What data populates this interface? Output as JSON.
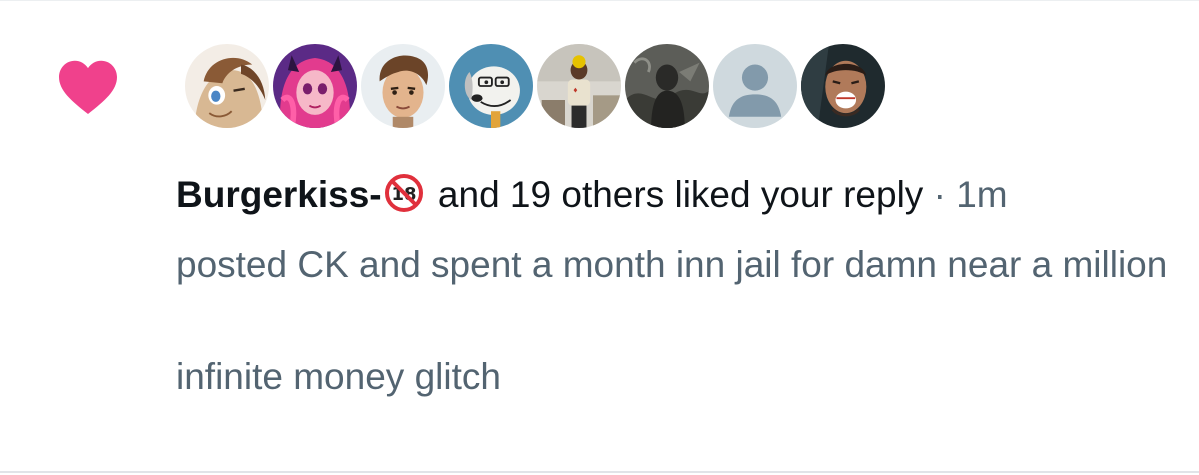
{
  "notification": {
    "type_icon": "heart-icon",
    "accent_color": "#f91880",
    "avatars": [
      {
        "name": "avatar-pony",
        "icon": "avatar-1"
      },
      {
        "name": "avatar-pink-hair",
        "icon": "avatar-2"
      },
      {
        "name": "avatar-brown-hair",
        "icon": "avatar-3"
      },
      {
        "name": "avatar-cartoon-dog",
        "icon": "avatar-4"
      },
      {
        "name": "avatar-photo-person",
        "icon": "avatar-5"
      },
      {
        "name": "avatar-dark-figure",
        "icon": "avatar-6"
      },
      {
        "name": "avatar-default",
        "icon": "default-avatar-icon"
      },
      {
        "name": "avatar-screaming-man",
        "icon": "avatar-8"
      }
    ],
    "username": "Burgerkiss-",
    "username_badge": "18",
    "action_text": " and 19 others liked your reply",
    "separator": " · ",
    "time": "1m",
    "reply_text": "posted CK and spent a month inn jail for damn near a million\n\ninfinite money glitch"
  }
}
